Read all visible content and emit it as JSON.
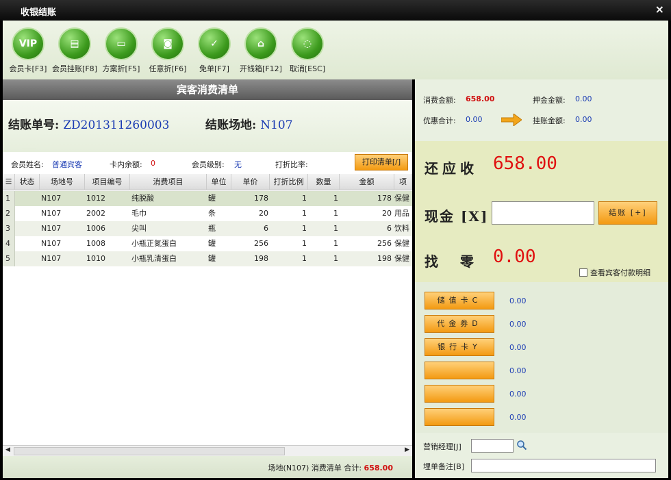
{
  "window": {
    "title": "收银结账",
    "close_glyph": "×"
  },
  "toolbar": [
    {
      "icon_text": "VIP",
      "label": "会员卡[F3]"
    },
    {
      "icon_text": "▤",
      "label": "会员挂账[F8]"
    },
    {
      "icon_text": "▭",
      "label": "方案折[F5]"
    },
    {
      "icon_text": "◙",
      "label": "任意折[F6]"
    },
    {
      "icon_text": "✓",
      "label": "免单[F7]"
    },
    {
      "icon_text": "⌂",
      "label": "开钱箱[F12]"
    },
    {
      "icon_text": "◌",
      "label": "取消[ESC]"
    }
  ],
  "left": {
    "header": "宾客消费清单",
    "bill_label": "结账单号:",
    "bill_value": "ZD201311260003",
    "venue_label": "结账场地:",
    "venue_value": "N107",
    "member_name_label": "会员姓名:",
    "member_name_value": "普通宾客",
    "card_balance_label": "卡内余额:",
    "card_balance_value": "0",
    "member_level_label": "会员级别:",
    "member_level_value": "无",
    "discount_label": "打折比率:",
    "print_button": "打印清单[/]",
    "columns": [
      "状态",
      "场地号",
      "项目编号",
      "消费项目",
      "单位",
      "单价",
      "打折比例",
      "数量",
      "金额",
      "项"
    ],
    "rows": [
      {
        "n": "1",
        "venue": "N107",
        "code": "1012",
        "item": "纯脱酸",
        "unit": "罐",
        "price": "178",
        "disc": "1",
        "qty": "1",
        "amount": "178",
        "cat": "保健"
      },
      {
        "n": "2",
        "venue": "N107",
        "code": "2002",
        "item": "毛巾",
        "unit": "条",
        "price": "20",
        "disc": "1",
        "qty": "1",
        "amount": "20",
        "cat": "用品"
      },
      {
        "n": "3",
        "venue": "N107",
        "code": "1006",
        "item": "尖叫",
        "unit": "瓶",
        "price": "6",
        "disc": "1",
        "qty": "1",
        "amount": "6",
        "cat": "饮料"
      },
      {
        "n": "4",
        "venue": "N107",
        "code": "1008",
        "item": "小瓶正氮蛋白",
        "unit": "罐",
        "price": "256",
        "disc": "1",
        "qty": "1",
        "amount": "256",
        "cat": "保健"
      },
      {
        "n": "5",
        "venue": "N107",
        "code": "1010",
        "item": "小瓶乳清蛋白",
        "unit": "罐",
        "price": "198",
        "disc": "1",
        "qty": "1",
        "amount": "198",
        "cat": "保健"
      }
    ],
    "footer_text": "场地(N107) 消费清单 合计:",
    "footer_total": "658.00"
  },
  "right": {
    "consume_label": "消费金额:",
    "consume_value": "658.00",
    "deposit_label": "押金金额:",
    "deposit_value": "0.00",
    "discount_total_label": "优惠合计:",
    "discount_total_value": "0.00",
    "credit_label": "挂账金额:",
    "credit_value": "0.00",
    "due_label": "还应收",
    "due_value": "658.00",
    "cash_label": "现金 [X]",
    "checkout_button": "结账 [+]",
    "change_label": "找  零",
    "change_value": "0.00",
    "view_detail_label": "查看宾客付款明细",
    "methods": [
      {
        "label": "储值卡C",
        "value": "0.00"
      },
      {
        "label": "代金券D",
        "value": "0.00"
      },
      {
        "label": "银行卡Y",
        "value": "0.00"
      },
      {
        "label": "",
        "value": "0.00"
      },
      {
        "label": "",
        "value": "0.00"
      },
      {
        "label": "",
        "value": "0.00"
      }
    ],
    "manager_label": "营销经理[J]",
    "remark_label": "埋单备注[B]"
  }
}
